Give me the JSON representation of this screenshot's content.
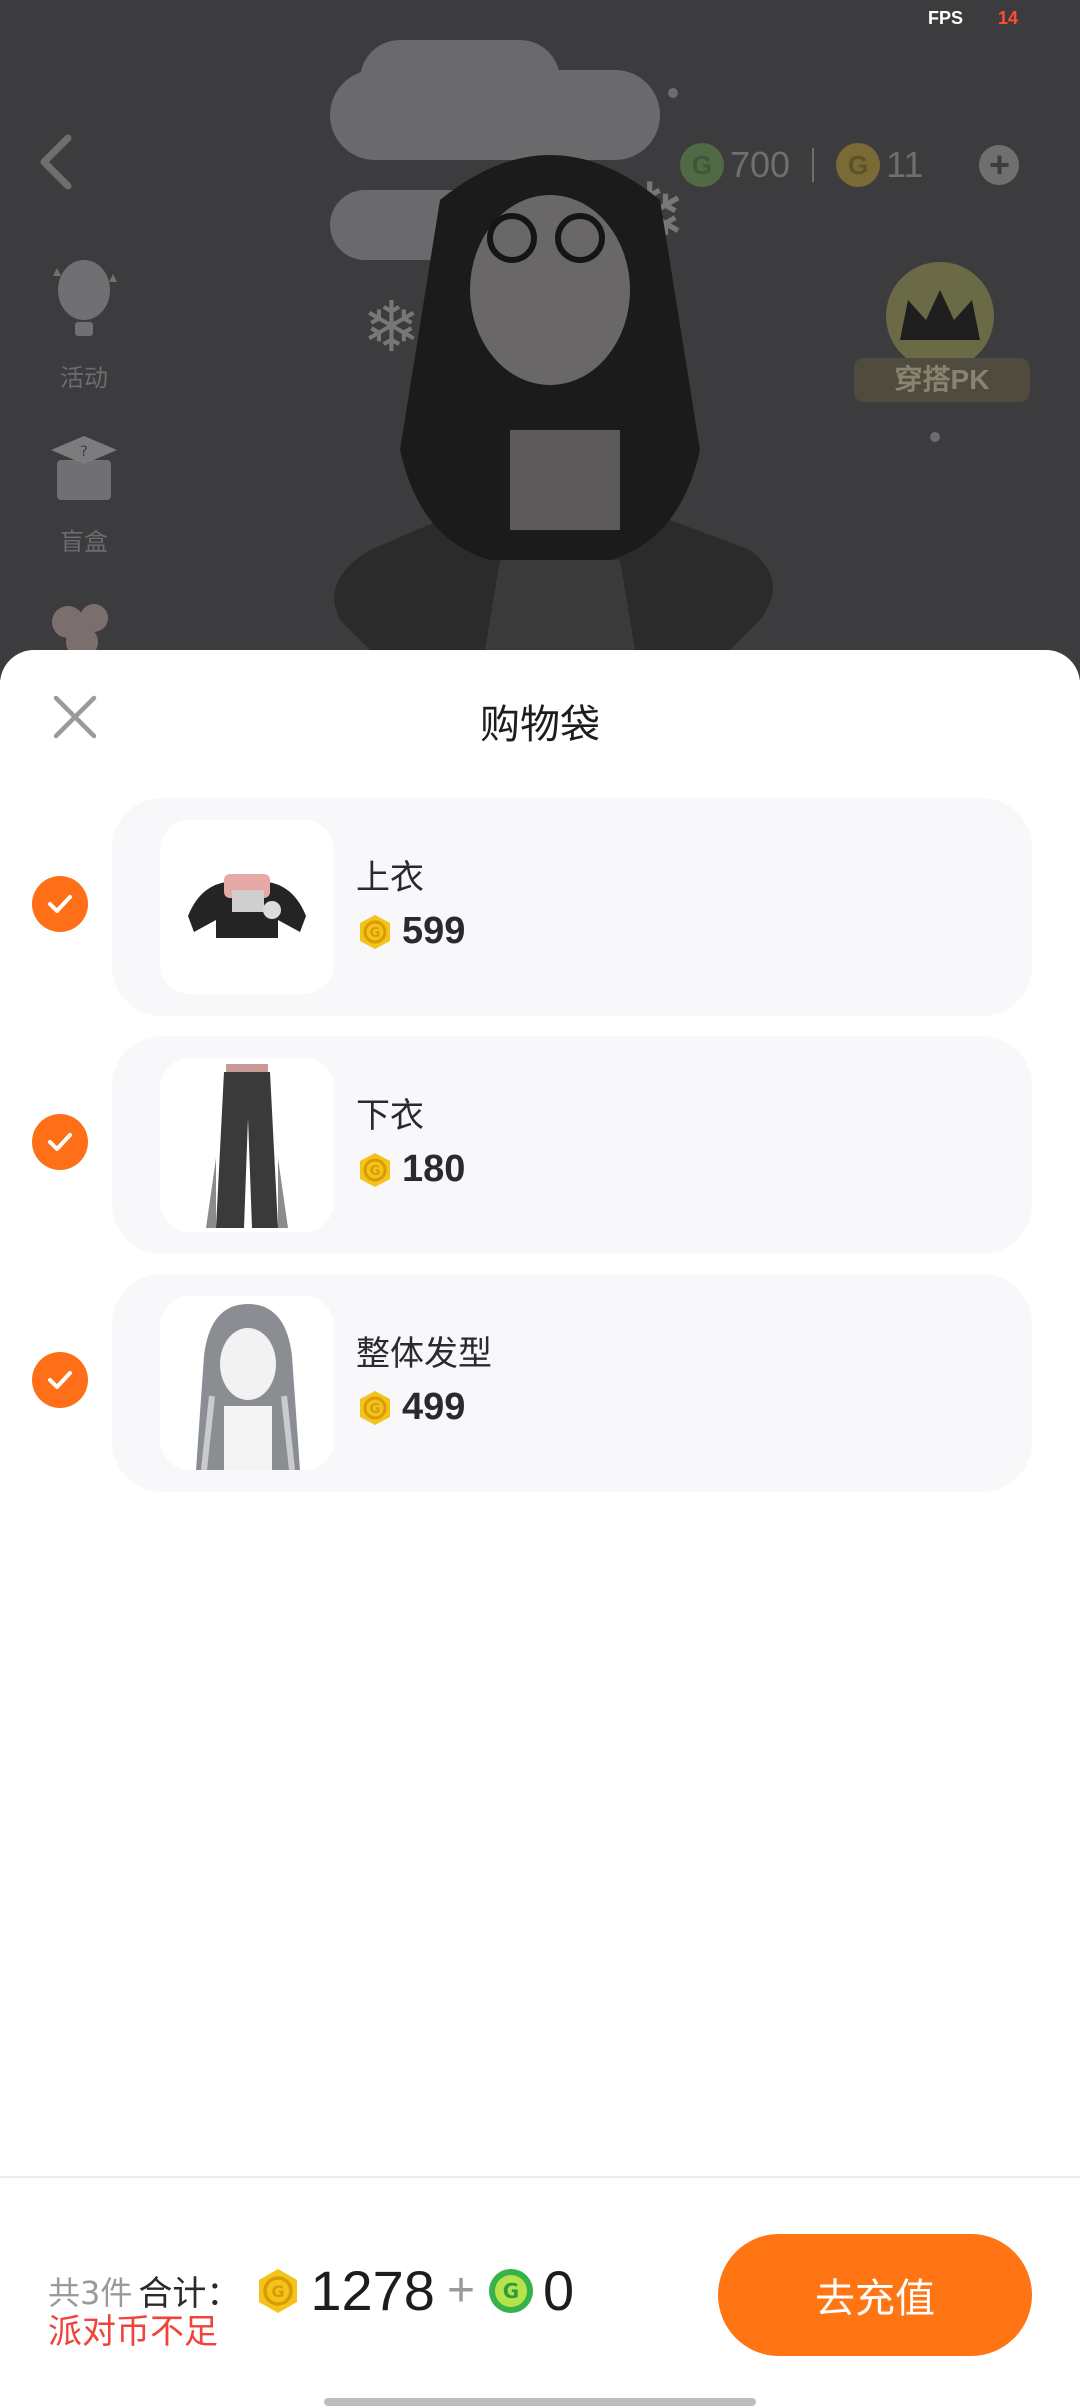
{
  "status": {
    "fps_label": "FPS",
    "fps_value": "14"
  },
  "scene": {
    "side_buttons": [
      {
        "label": "活动",
        "icon": "balloon-icon"
      },
      {
        "label": "盲盒",
        "icon": "blind-box-icon"
      }
    ],
    "currency": {
      "green_coins": "700",
      "gold_coins": "11"
    },
    "pk_button_label": "穿搭PK"
  },
  "sheet": {
    "title": "购物袋",
    "items": [
      {
        "name": "上衣",
        "price": "599",
        "checked": true,
        "thumb": "jacket-image"
      },
      {
        "name": "下衣",
        "price": "180",
        "checked": true,
        "thumb": "jeans-image"
      },
      {
        "name": "整体发型",
        "price": "499",
        "checked": true,
        "thumb": "hairstyle-image"
      }
    ]
  },
  "footer": {
    "count_text": "共3件",
    "total_label": "合计：",
    "total_gold": "1278",
    "plus": "+",
    "total_green": "0",
    "warning": "派对币不足",
    "recharge_label": "去充值"
  },
  "colors": {
    "accent": "#ff7413",
    "warning": "#f2433a",
    "gold": "#f5c21a",
    "green": "#36b24a"
  }
}
